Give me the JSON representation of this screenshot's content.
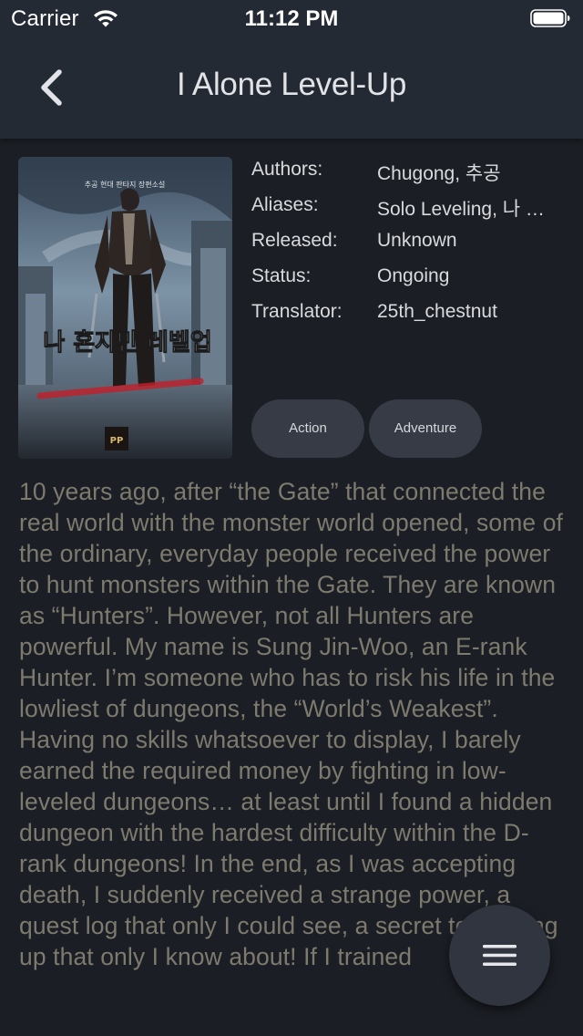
{
  "status_bar": {
    "carrier": "Carrier",
    "time": "11:12 PM",
    "wifi_icon": "wifi-icon",
    "battery_icon": "battery-icon"
  },
  "nav": {
    "title": "I Alone Level-Up",
    "back_icon": "chevron-left-icon"
  },
  "details": {
    "authors_label": "Authors:",
    "authors_value": "Chugong,  추공",
    "aliases_label": "Aliases:",
    "aliases_value": "Solo Leveling, 나 혼자만 레벨업",
    "released_label": "Released:",
    "released_value": "Unknown",
    "status_label": "Status:",
    "status_value": "Ongoing",
    "translator_label": "Translator:",
    "translator_value": "25th_chestnut"
  },
  "cover": {
    "title_text": "나 혼자만 레벨업",
    "subtitle_text": "추공 현대 판타지 장편소설",
    "publisher_text": "PP"
  },
  "tags": [
    "Action",
    "Adventure"
  ],
  "description": "10 years ago, after “the Gate” that connected the real world with the monster world opened, some of the ordinary, everyday people received the power to hunt monsters within the Gate. They are known as “Hunters”. However, not all Hunters are powerful. My name is Sung Jin-Woo, an E-rank Hunter. I’m someone who has to risk his life in the lowliest of dungeons, the “World’s Weakest”. Having no skills whatsoever to display, I barely earned the required money by fighting in low-leveled dungeons… at least until I found a hidden dungeon with the hardest difficulty within the D-rank dungeons! In the end, as I was accepting death, I suddenly received a strange power, a quest log that only I could see, a secret to leveling up that only I know about! If I trained",
  "fab": {
    "icon": "menu-icon"
  },
  "colors": {
    "background": "#1b1e24",
    "header": "#242a34",
    "tag": "#363b45",
    "description_text": "#7d7a6e"
  }
}
